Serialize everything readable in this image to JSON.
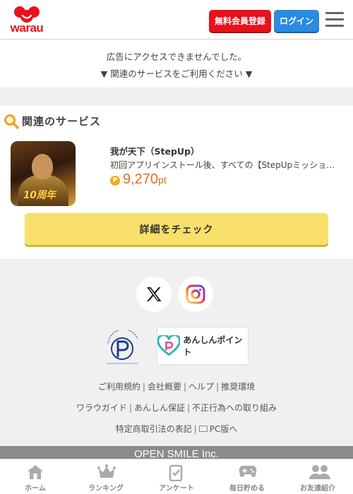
{
  "header": {
    "logo_text": "warau",
    "register_label": "無料会員登録",
    "login_label": "ログイン"
  },
  "ad": {
    "line1": "広告にアクセスできませんでした。",
    "line2": "▼ 関連のサービスをご利用ください ▼"
  },
  "service": {
    "section_title": "関連のサービス",
    "item": {
      "name": "我が天下（StepUp）",
      "description": "初回アプリインストール後、すべての【StepUpミッション】達成でポイント獲得",
      "point_badge": "P",
      "points": "9,270",
      "point_unit": "pt",
      "thumb_text": "10周年"
    },
    "detail_button": "詳細をチェック"
  },
  "footer": {
    "links_row1": [
      "ご利用規約",
      "会社概要",
      "ヘルプ",
      "推奨環境"
    ],
    "links_row2": [
      "ワラウガイド",
      "あんしん保証",
      "不正行為への取り組み"
    ],
    "links_row3": [
      "特定商取引法の表記",
      "PC版へ"
    ],
    "separator": "|",
    "privacy_mark_number": "10820020(11)",
    "privacy_mark_text": "たいせつにしますプライバシー",
    "anshin_label": "あんしんポイント",
    "company": "OPEN SMILE Inc."
  },
  "tabbar": {
    "items": [
      {
        "label": "ホーム",
        "icon": "home-icon"
      },
      {
        "label": "ランキング",
        "icon": "crown-icon"
      },
      {
        "label": "アンケート",
        "icon": "survey-icon"
      },
      {
        "label": "毎日貯める",
        "icon": "gamepad-icon"
      },
      {
        "label": "お友達紹介",
        "icon": "friends-icon"
      }
    ]
  },
  "colors": {
    "brand_red": "#e8111c",
    "login_blue": "#2a8be0",
    "points_orange": "#e66a1c",
    "cta_yellow": "#f8e06a"
  }
}
